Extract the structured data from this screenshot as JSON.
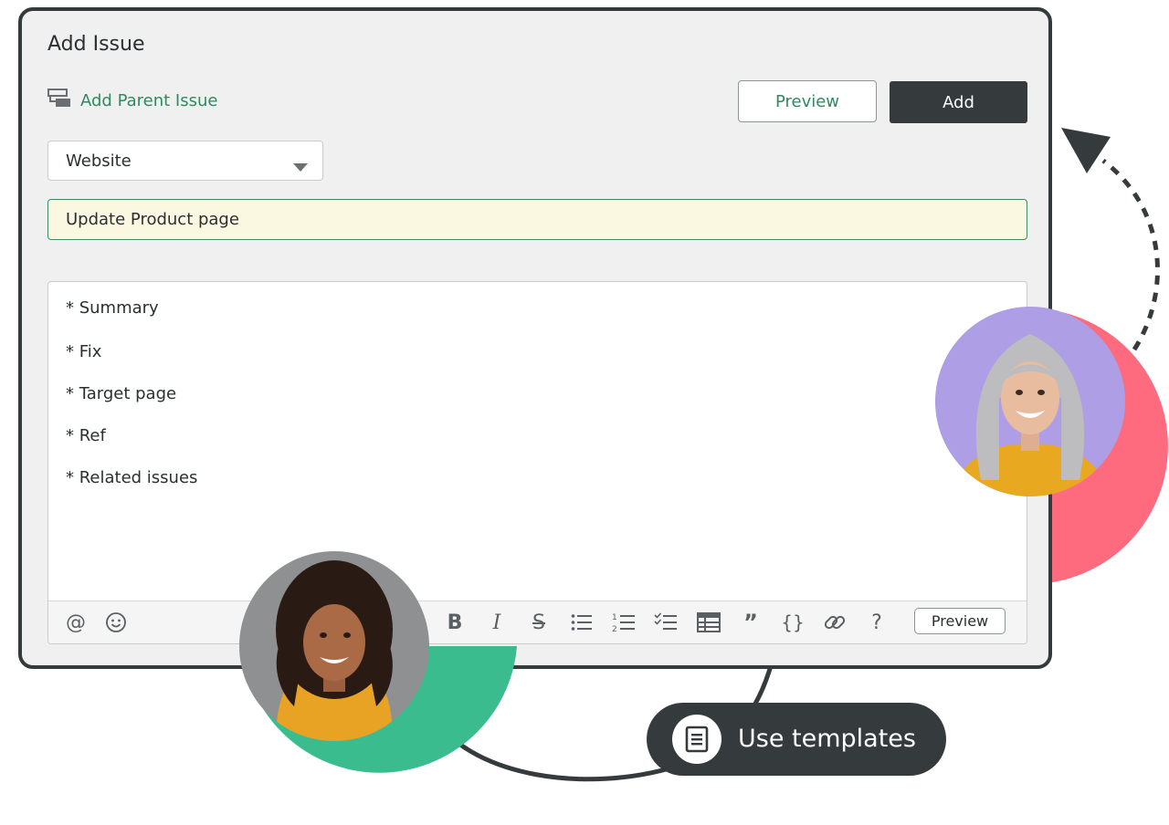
{
  "panel": {
    "title": "Add Issue",
    "add_parent_label": "Add Parent Issue",
    "preview_label": "Preview",
    "add_label": "Add",
    "project_select": {
      "value": "Website"
    },
    "summary_input": {
      "value": "Update Product page"
    },
    "description_lines": [
      "* Summary",
      "* Fix",
      "* Target page",
      "* Ref",
      "* Related issues"
    ],
    "toolbar": {
      "items": [
        "mention-icon",
        "emoji-icon",
        "bold-icon",
        "italic-icon",
        "strikethrough-icon",
        "bulleted-list-icon",
        "numbered-list-icon",
        "checklist-icon",
        "table-icon",
        "quote-icon",
        "code-icon",
        "link-icon",
        "help-icon"
      ],
      "preview_label": "Preview"
    }
  },
  "badge": {
    "label": "Use templates",
    "icon": "document-icon"
  },
  "colors": {
    "accent_green": "#2f8a5f",
    "dark": "#353a3c",
    "highlight_bg": "#fbf8e2",
    "decor_green": "#3bbc8e",
    "decor_red": "#ff6b7e",
    "avatar_purple": "#ad9ee6"
  }
}
